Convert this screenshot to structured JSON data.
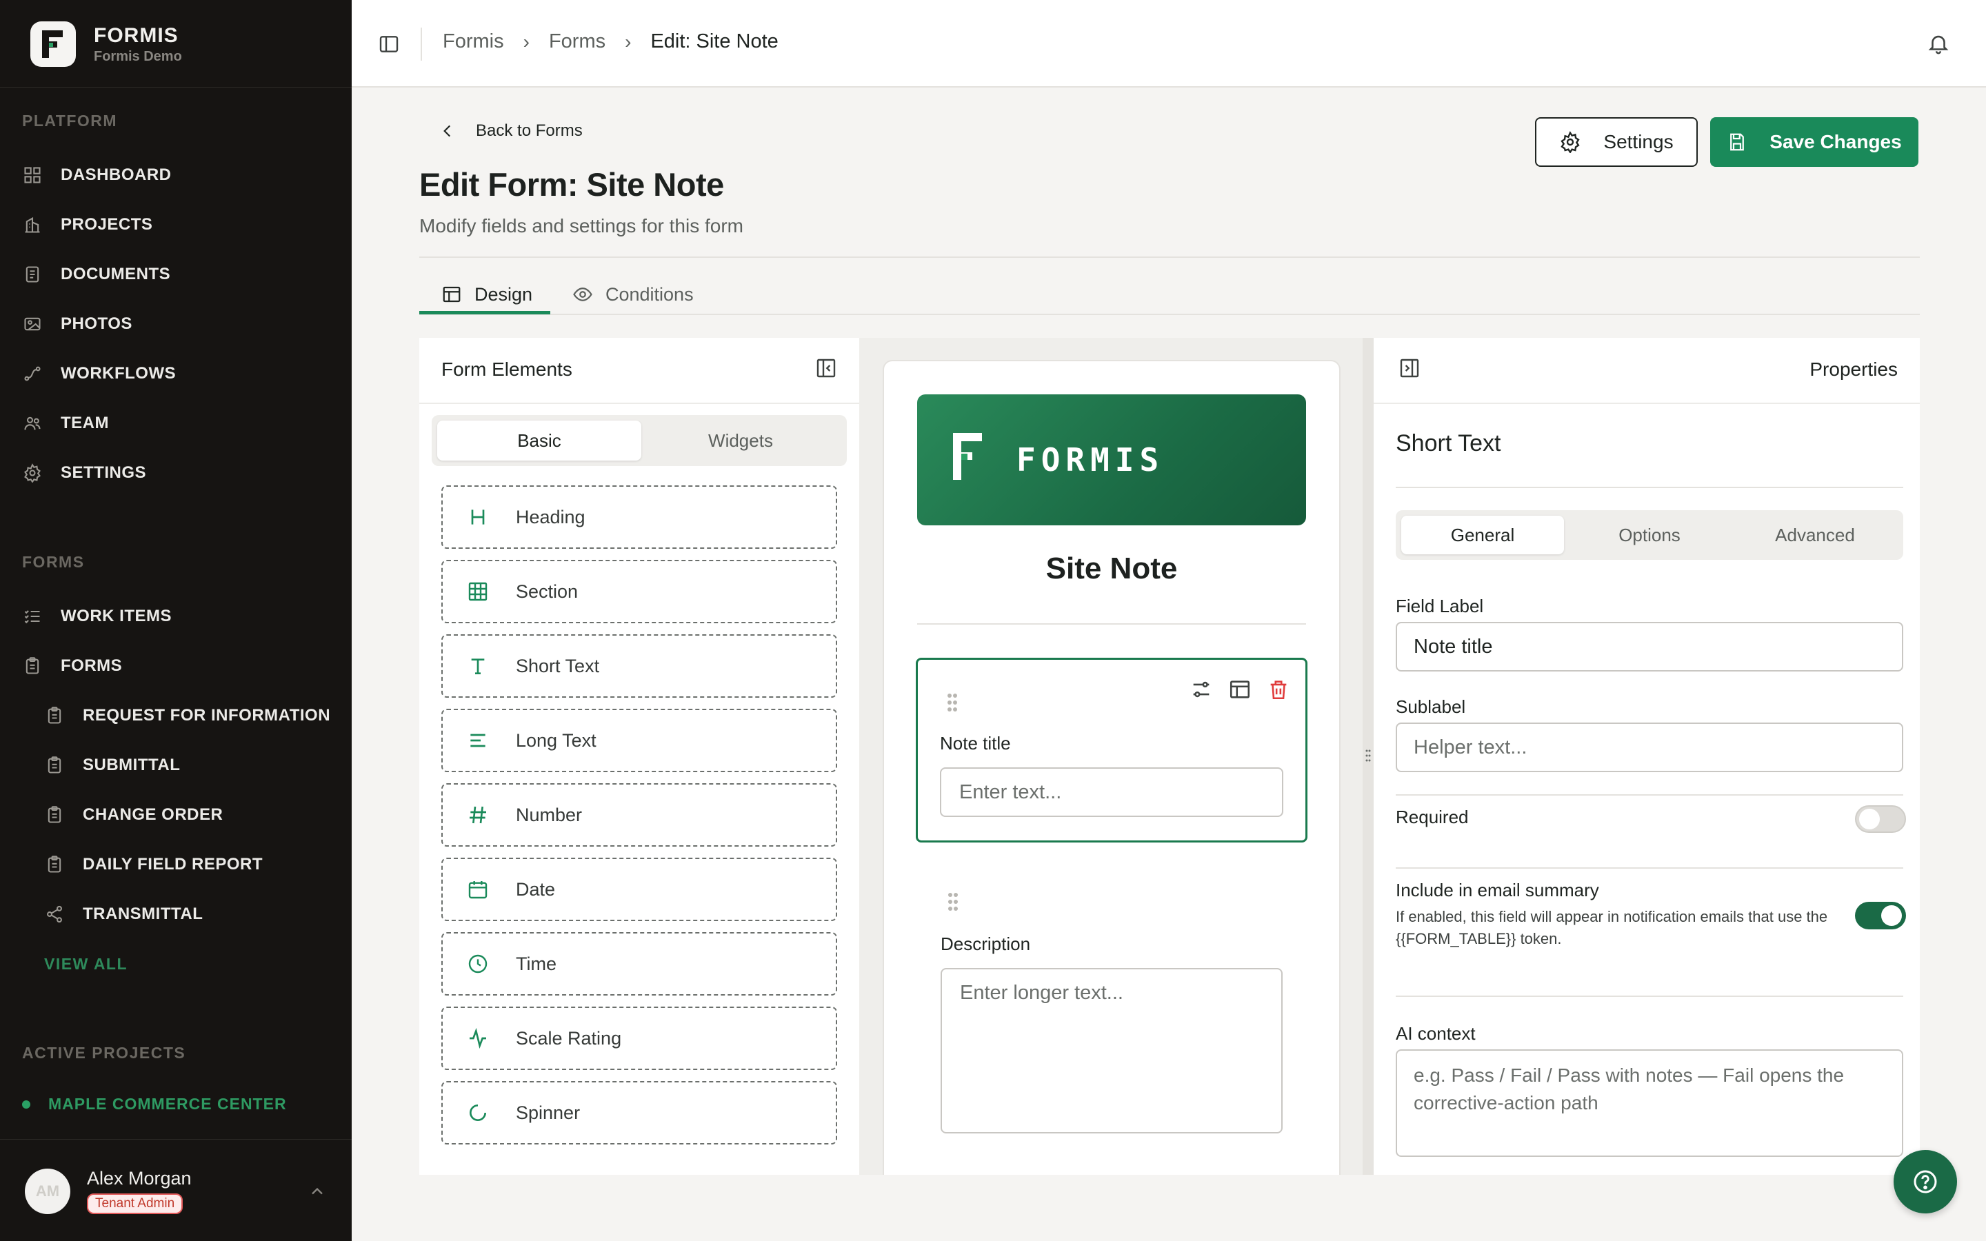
{
  "brand": {
    "name": "FORMIS",
    "workspace": "Formis Demo"
  },
  "sidebar": {
    "platform_label": "PLATFORM",
    "platform_items": [
      {
        "label": "DASHBOARD",
        "icon": "dashboard-icon"
      },
      {
        "label": "PROJECTS",
        "icon": "building-icon"
      },
      {
        "label": "DOCUMENTS",
        "icon": "document-icon"
      },
      {
        "label": "PHOTOS",
        "icon": "photos-icon"
      },
      {
        "label": "WORKFLOWS",
        "icon": "workflow-icon"
      },
      {
        "label": "TEAM",
        "icon": "team-icon"
      },
      {
        "label": "SETTINGS",
        "icon": "gear-icon"
      }
    ],
    "forms_label": "FORMS",
    "forms_items": [
      {
        "label": "WORK ITEMS",
        "icon": "list-check-icon"
      },
      {
        "label": "FORMS",
        "icon": "clipboard-icon"
      }
    ],
    "form_subitems": [
      {
        "label": "REQUEST FOR INFORMATION",
        "icon": "clipboard-icon"
      },
      {
        "label": "SUBMITTAL",
        "icon": "clipboard-icon"
      },
      {
        "label": "CHANGE ORDER",
        "icon": "clipboard-icon"
      },
      {
        "label": "DAILY FIELD REPORT",
        "icon": "clipboard-icon"
      },
      {
        "label": "TRANSMITTAL",
        "icon": "share-icon"
      }
    ],
    "view_all": "VIEW ALL",
    "active_projects_label": "ACTIVE PROJECTS",
    "active_projects": [
      {
        "label": "MAPLE COMMERCE CENTER"
      }
    ],
    "user": {
      "initials": "AM",
      "name": "Alex Morgan",
      "role": "Tenant Admin"
    }
  },
  "topbar": {
    "breadcrumbs": [
      "Formis",
      "Forms",
      "Edit: Site Note"
    ]
  },
  "header": {
    "back_label": "Back to Forms",
    "title": "Edit Form: Site Note",
    "subtitle": "Modify fields and settings for this form",
    "settings_label": "Settings",
    "save_label": "Save Changes"
  },
  "tabs": [
    {
      "label": "Design",
      "active": true
    },
    {
      "label": "Conditions",
      "active": false
    }
  ],
  "elements_panel": {
    "title": "Form Elements",
    "segments": [
      "Basic",
      "Widgets"
    ],
    "active_segment": "Basic",
    "items": [
      {
        "label": "Heading",
        "icon": "heading-icon"
      },
      {
        "label": "Section",
        "icon": "table-icon"
      },
      {
        "label": "Short Text",
        "icon": "text-icon"
      },
      {
        "label": "Long Text",
        "icon": "align-left-icon"
      },
      {
        "label": "Number",
        "icon": "hash-icon"
      },
      {
        "label": "Date",
        "icon": "calendar-icon"
      },
      {
        "label": "Time",
        "icon": "clock-icon"
      },
      {
        "label": "Scale Rating",
        "icon": "activity-icon"
      },
      {
        "label": "Spinner",
        "icon": "spinner-icon"
      }
    ]
  },
  "canvas": {
    "banner_text": "FORMIS",
    "form_title": "Site Note",
    "fields": [
      {
        "label": "Note title",
        "placeholder": "Enter text...",
        "selected": true
      },
      {
        "label": "Description",
        "placeholder": "Enter longer text...",
        "selected": false
      }
    ]
  },
  "properties": {
    "title": "Properties",
    "field_type": "Short Text",
    "tabs": [
      "General",
      "Options",
      "Advanced"
    ],
    "active_tab": "General",
    "field_label_label": "Field Label",
    "field_label_value": "Note title",
    "sublabel_label": "Sublabel",
    "sublabel_placeholder": "Helper text...",
    "required_label": "Required",
    "required": false,
    "email_summary_label": "Include in email summary",
    "email_summary_help": "If enabled, this field will appear in notification emails that use the {{FORM_TABLE}} token.",
    "email_summary": true,
    "ai_context_label": "AI context",
    "ai_context_placeholder": "e.g. Pass / Fail / Pass with notes — Fail opens the corrective-action path"
  },
  "colors": {
    "accent": "#1a8a5a",
    "sidebar_bg": "#161412",
    "danger": "#e03b3b"
  }
}
